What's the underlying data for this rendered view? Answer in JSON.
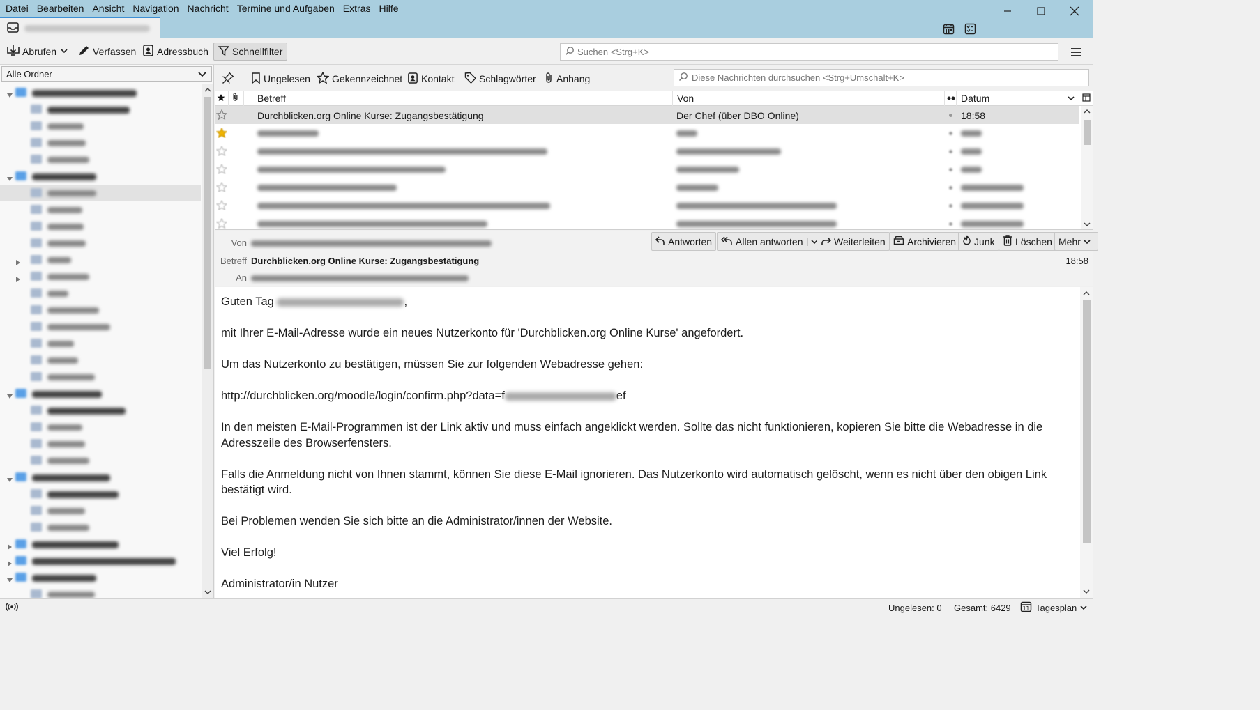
{
  "menubar": {
    "items": [
      "Datei",
      "Bearbeiten",
      "Ansicht",
      "Navigation",
      "Nachricht",
      "Termine und Aufgaben",
      "Extras",
      "Hilfe"
    ]
  },
  "window": {
    "controls": [
      "minimize-icon",
      "maximize-icon",
      "close-icon"
    ]
  },
  "tab": {
    "icon": "inbox-icon"
  },
  "toolbar": {
    "get_messages_label": "Abrufen",
    "write_label": "Verfassen",
    "address_book_label": "Adressbuch",
    "quick_filter_label": "Schnellfilter",
    "search_placeholder": "Suchen <Strg+K>"
  },
  "folderpane": {
    "selector_label": "Alle Ordner"
  },
  "quickfilter": {
    "unread_label": "Ungelesen",
    "starred_label": "Gekennzeichnet",
    "contact_label": "Kontakt",
    "tags_label": "Schlagwörter",
    "attachment_label": "Anhang",
    "search_placeholder": "Diese Nachrichten durchsuchen <Strg+Umschalt+K>"
  },
  "threadpane": {
    "columns": {
      "subject": "Betreff",
      "from": "Von",
      "date": "Datum"
    },
    "selected_row": {
      "subject": "Durchblicken.org Online Kurse: Zugangsbestätigung",
      "from": "Der Chef (über DBO Online)",
      "date": "18:58"
    }
  },
  "message": {
    "from_label": "Von",
    "subject_label": "Betreff",
    "to_label": "An",
    "subject": "Durchblicken.org Online Kurse: Zugangsbestätigung",
    "time": "18:58",
    "buttons": {
      "reply": "Antworten",
      "reply_all": "Allen antworten",
      "forward": "Weiterleiten",
      "archive": "Archivieren",
      "junk": "Junk",
      "delete": "Löschen",
      "more": "Mehr"
    },
    "body": {
      "greeting": "Guten Tag",
      "p1": "mit Ihrer E-Mail-Adresse wurde ein neues Nutzerkonto für 'Durchblicken.org Online Kurse' angefordert.",
      "p2": "Um das Nutzerkonto zu bestätigen, müssen Sie zur folgenden Webadresse gehen:",
      "link_start": "http://durchblicken.org/moodle/login/confirm.php?data=f",
      "link_end": "ef",
      "p3": "In den meisten E-Mail-Programmen ist der Link aktiv und muss einfach angeklickt werden. Sollte das nicht funktionieren, kopieren Sie bitte die Webadresse in die Adresszeile des Browserfensters.",
      "p4": "Falls die Anmeldung nicht von Ihnen stammt, können Sie diese E-Mail ignorieren. Das Nutzerkonto wird automatisch gelöscht, wenn es nicht über den obigen Link bestätigt wird.",
      "p5": "Bei Problemen wenden Sie sich bitte an die Administrator/innen der Website.",
      "p6": "Viel Erfolg!",
      "signature": "Administrator/in Nutzer"
    }
  },
  "statusbar": {
    "unread": "Ungelesen: 0",
    "total": "Gesamt: 6429",
    "today_pane": "Tagesplan"
  }
}
